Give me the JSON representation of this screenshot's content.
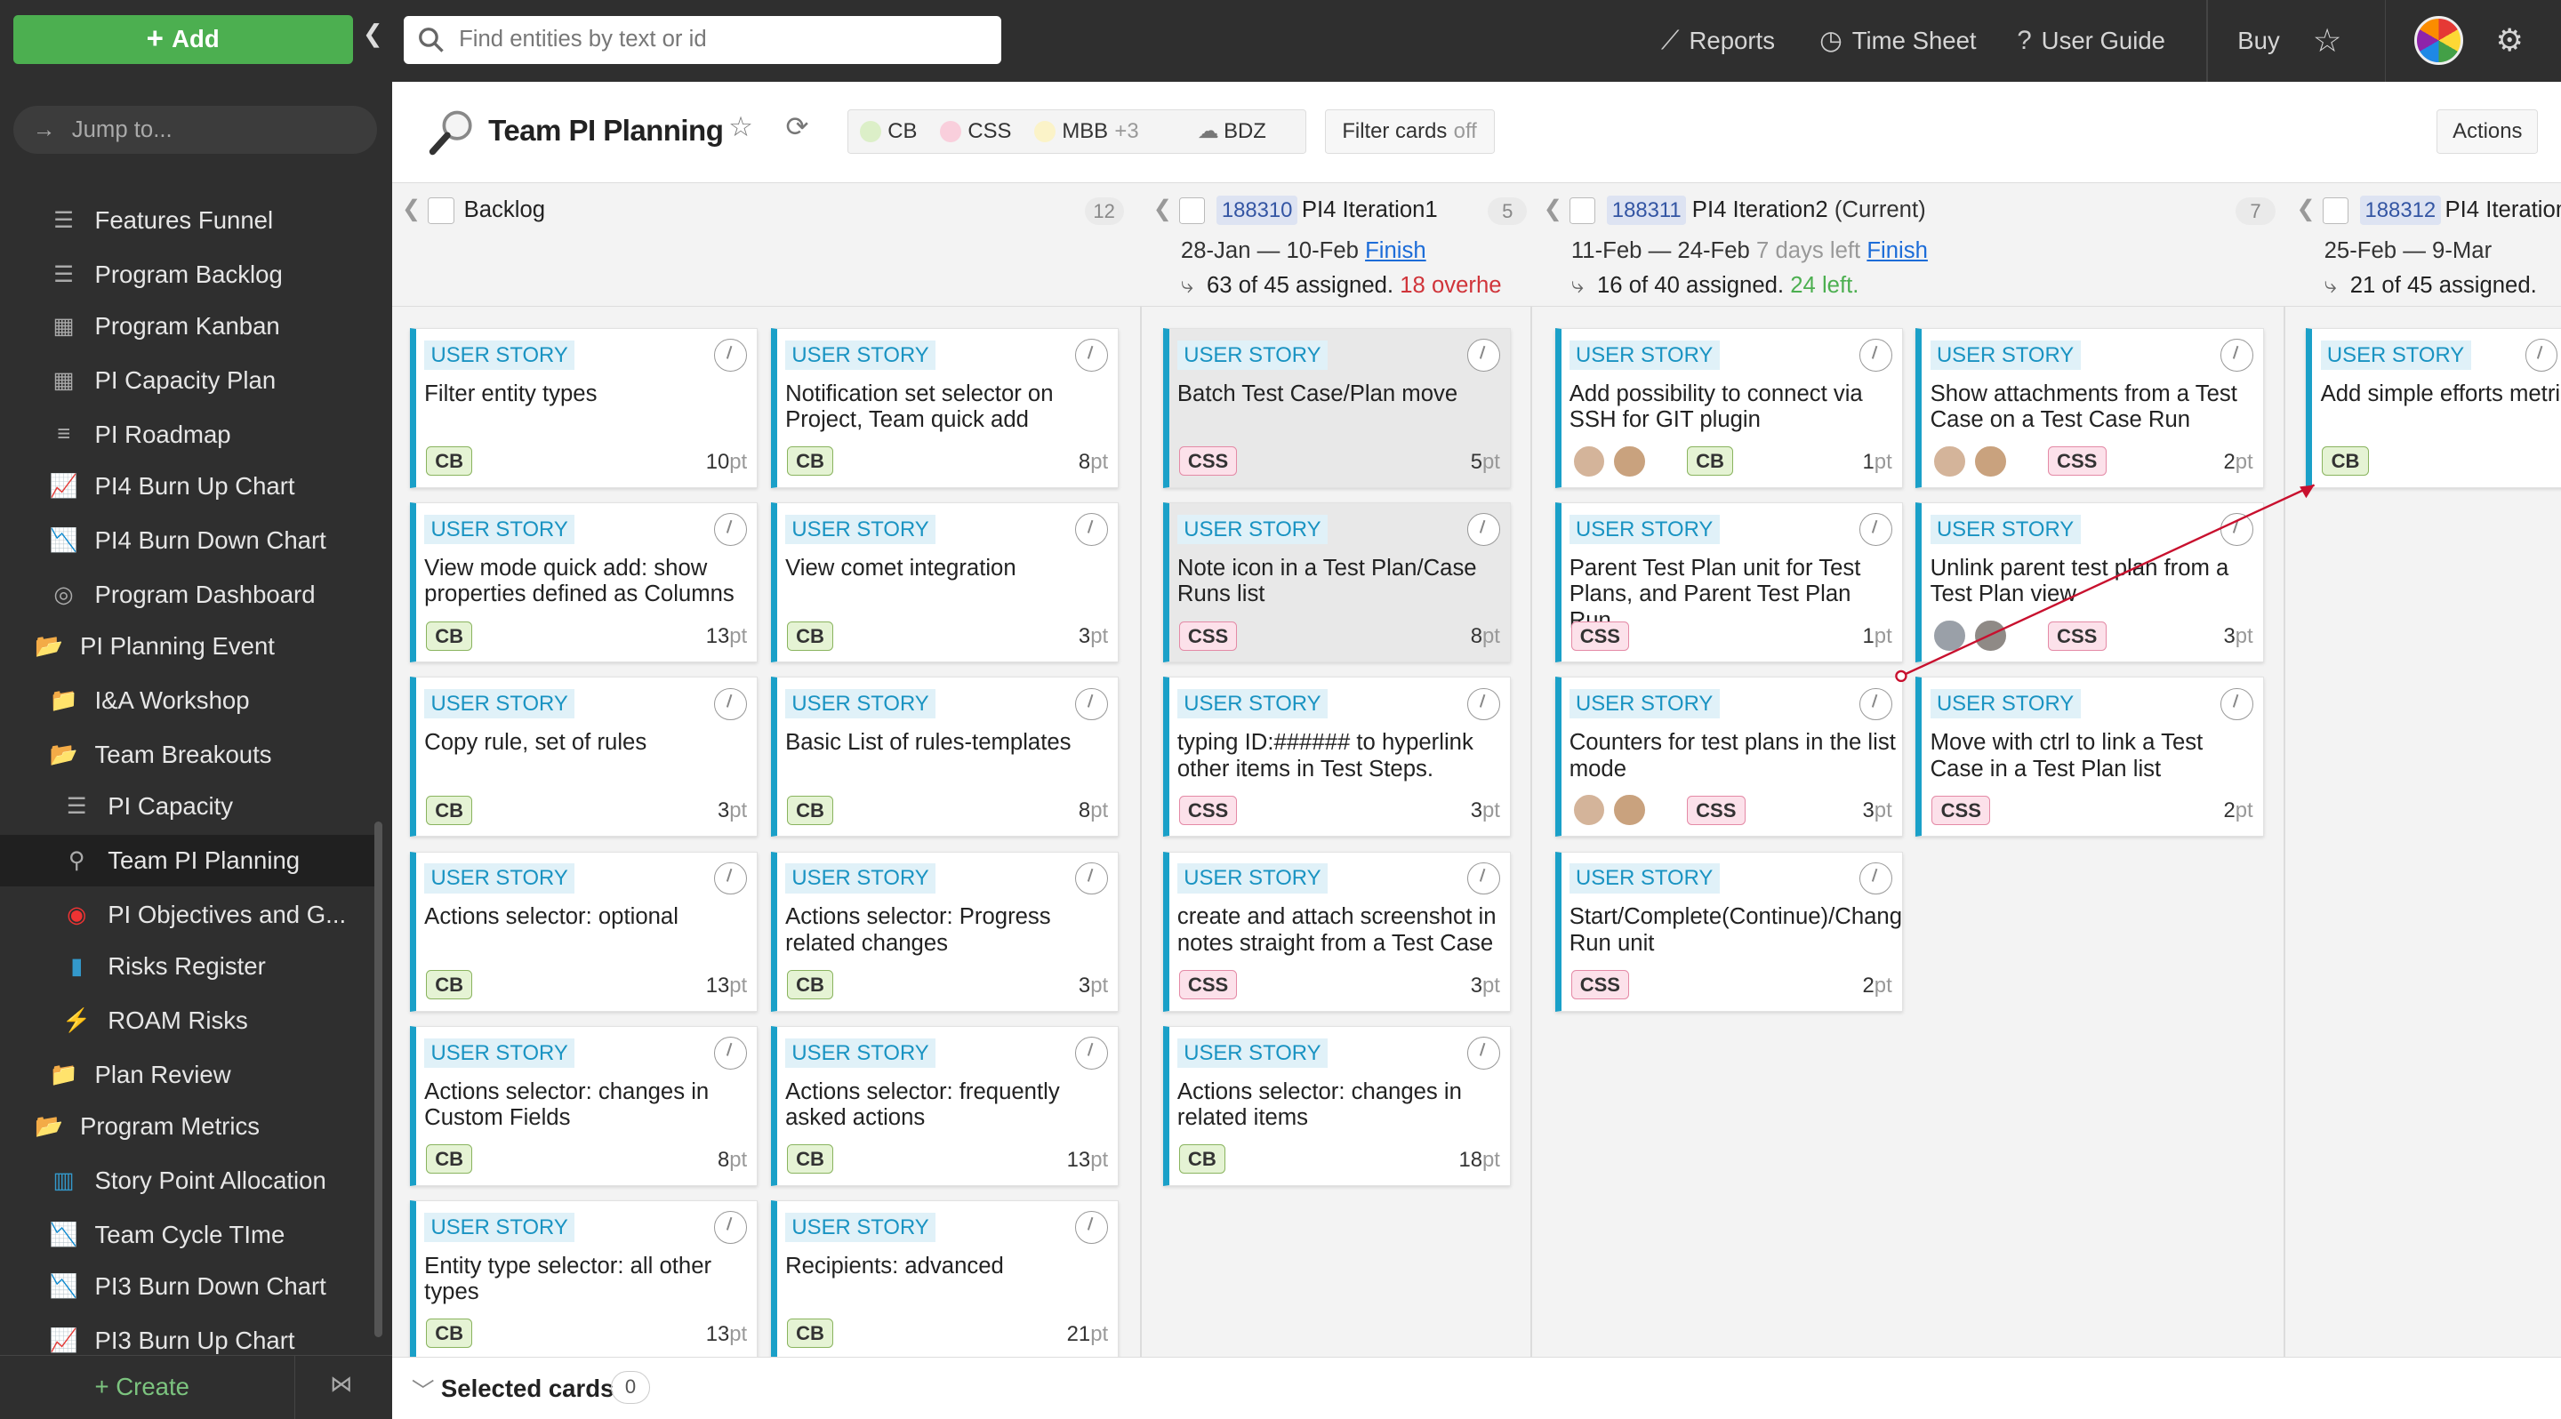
{
  "topbar": {
    "add_label": "Add",
    "search_placeholder": "Find entities by text or id",
    "reports": "Reports",
    "timesheet": "Time Sheet",
    "guide": "User Guide",
    "buy": "Buy"
  },
  "sidebar": {
    "jump": "Jump to...",
    "items": [
      "Features Funnel",
      "Program Backlog",
      "Program Kanban",
      "PI Capacity Plan",
      "PI Roadmap",
      "PI4 Burn Up Chart",
      "PI4 Burn Down Chart",
      "Program Dashboard",
      "PI Planning Event",
      "I&A Workshop",
      "Team Breakouts",
      "PI Capacity",
      "Team PI Planning",
      "PI Objectives and G...",
      "Risks Register",
      "ROAM Risks",
      "Plan Review",
      "Program Metrics",
      "Story Point Allocation",
      "Team Cycle TIme",
      "PI3 Burn Down Chart",
      "PI3 Burn Up Chart"
    ],
    "create": "Create"
  },
  "header": {
    "title": "Team PI Planning",
    "teams": [
      "CB",
      "CSS",
      "MBB",
      "+3",
      "BDZ"
    ],
    "filter_label": "Filter cards",
    "filter_state": "off",
    "actions": "Actions"
  },
  "columns": [
    {
      "name": "Backlog",
      "count": "12"
    },
    {
      "id": "188310",
      "name": "PI4 Iteration1",
      "count": "5",
      "dates": "28-Jan — 10-Feb",
      "finish": "Finish",
      "assigned": "63 of 45 assigned.",
      "note": "18 overhe"
    },
    {
      "id": "188311",
      "name": "PI4 Iteration2",
      "cur": "(Current)",
      "count": "7",
      "dates": "11-Feb — 24-Feb",
      "left": "7 days left",
      "finish": "Finish",
      "assigned": "16 of 40 assigned.",
      "note": "24 left."
    },
    {
      "id": "188312",
      "name": "PI4 Iteration",
      "dates": "25-Feb — 9-Mar",
      "assigned": "21 of 45 assigned."
    }
  ],
  "card_type": "USER STORY",
  "pt_unit": "pt",
  "cards": {
    "backlog_a": [
      {
        "title": "Filter entity types",
        "tag": "CB",
        "pts": "10"
      },
      {
        "title": "View mode quick add: show properties defined as Columns",
        "tag": "CB",
        "pts": "13"
      },
      {
        "title": "Copy rule, set of rules",
        "tag": "CB",
        "pts": "3"
      },
      {
        "title": "Actions selector: optional",
        "tag": "CB",
        "pts": "13"
      },
      {
        "title": "Actions selector: changes in Custom Fields",
        "tag": "CB",
        "pts": "8"
      },
      {
        "title": "Entity type selector: all other types",
        "tag": "CB",
        "pts": "13"
      }
    ],
    "backlog_b": [
      {
        "title": "Notification set selector on Project, Team quick add",
        "tag": "CB",
        "pts": "8"
      },
      {
        "title": "View comet integration",
        "tag": "CB",
        "pts": "3"
      },
      {
        "title": "Basic List of rules-templates",
        "tag": "CB",
        "pts": "8"
      },
      {
        "title": "Actions selector: Progress related changes",
        "tag": "CB",
        "pts": "3"
      },
      {
        "title": "Actions selector: frequently asked actions",
        "tag": "CB",
        "pts": "13"
      },
      {
        "title": "Recipients: advanced",
        "tag": "CB",
        "pts": "21"
      }
    ],
    "iter1": [
      {
        "title": "Batch Test Case/Plan move",
        "tag": "CSS",
        "pts": "5"
      },
      {
        "title": "Note icon in a Test Plan/Case Runs list",
        "tag": "CSS",
        "pts": "8"
      },
      {
        "title": "typing ID:###### to hyperlink other items in Test Steps.",
        "tag": "CSS",
        "pts": "3"
      },
      {
        "title": "create and attach screenshot in notes straight from a Test Case",
        "tag": "CSS",
        "pts": "3"
      },
      {
        "title": "Actions selector: changes in related items",
        "tag": "CB",
        "pts": "18"
      }
    ],
    "iter2_a": [
      {
        "title": "Add possibility to connect via SSH for GIT plugin",
        "tag": "CB",
        "pts": "1"
      },
      {
        "title": "Parent Test Plan unit for Test Plans, and Parent Test Plan Run",
        "tag": "CSS",
        "pts": "1"
      },
      {
        "title": "Counters for test plans in the list mode",
        "tag": "CSS",
        "pts": "3"
      },
      {
        "title": "Start/Complete(Continue)/Chang Run unit",
        "tag": "CSS",
        "pts": "2"
      }
    ],
    "iter2_b": [
      {
        "title": "Show attachments from a Test Case on a Test Case Run",
        "tag": "CSS",
        "pts": "2"
      },
      {
        "title": "Unlink parent test plan from a Test Plan view",
        "tag": "CSS",
        "pts": "3"
      },
      {
        "title": "Move with ctrl to link a Test Case in a Test Plan list",
        "tag": "CSS",
        "pts": "2"
      }
    ],
    "iter3": [
      {
        "title": "Add simple efforts metri",
        "tag": "CB"
      }
    ]
  },
  "selected": {
    "label": "Selected cards",
    "count": "0"
  },
  "colors": {
    "accent": "#4caf50",
    "card_border": "#1aa0c8",
    "dependency_line": "#c8102e"
  }
}
